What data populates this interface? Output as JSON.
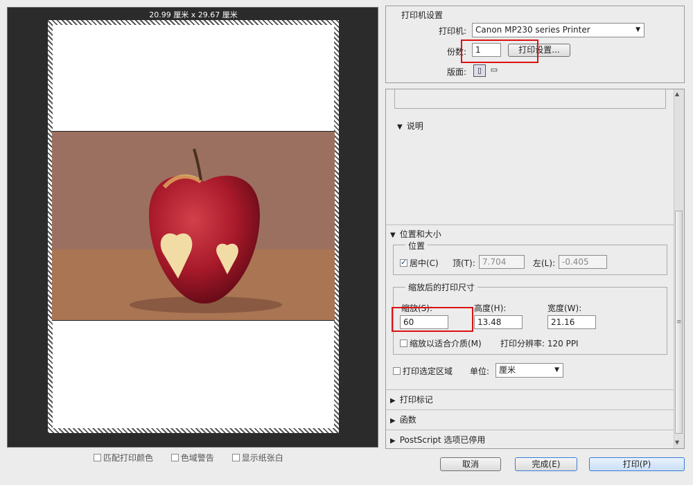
{
  "preview": {
    "dimensions": "20.99 厘米 x 29.67 厘米"
  },
  "preview_options": [
    {
      "label": "匹配打印颜色",
      "checked": false
    },
    {
      "label": "色域警告",
      "checked": false
    },
    {
      "label": "显示纸张白",
      "checked": false
    }
  ],
  "printer_settings": {
    "heading": "打印机设置",
    "printer_label": "打印机:",
    "printer_value": "Canon MP230 series Printer",
    "copies_label": "份数:",
    "copies_value": "1",
    "print_settings_button": "打印设置...",
    "layout_label": "版面:"
  },
  "description": {
    "heading": "说明"
  },
  "position_size": {
    "heading": "位置和大小",
    "position_group": "位置",
    "center_label": "居中(C)",
    "center_checked": true,
    "top_label": "顶(T):",
    "top_value": "7.704",
    "left_label": "左(L):",
    "left_value": "-0.405",
    "scaled_group": "缩放后的打印尺寸",
    "scale_label": "缩放(S):",
    "scale_value": "60",
    "height_label": "高度(H):",
    "height_value": "13.48",
    "width_label": "宽度(W):",
    "width_value": "21.16",
    "fit_media_label": "缩放以适合介质(M)",
    "fit_media_checked": false,
    "resolution_text": "打印分辨率: 120 PPI"
  },
  "print_selected": {
    "label": "打印选定区域",
    "checked": false,
    "unit_label": "单位:",
    "unit_value": "厘米"
  },
  "collapsed_sections": {
    "marks": "打印标记",
    "functions": "函数",
    "postscript": "PostScript 选项已停用"
  },
  "footer": {
    "cancel": "取消",
    "done": "完成(E)",
    "print": "打印(P)"
  },
  "colors": {
    "highlight": "#d11111",
    "accent": "#1a3a8a"
  }
}
